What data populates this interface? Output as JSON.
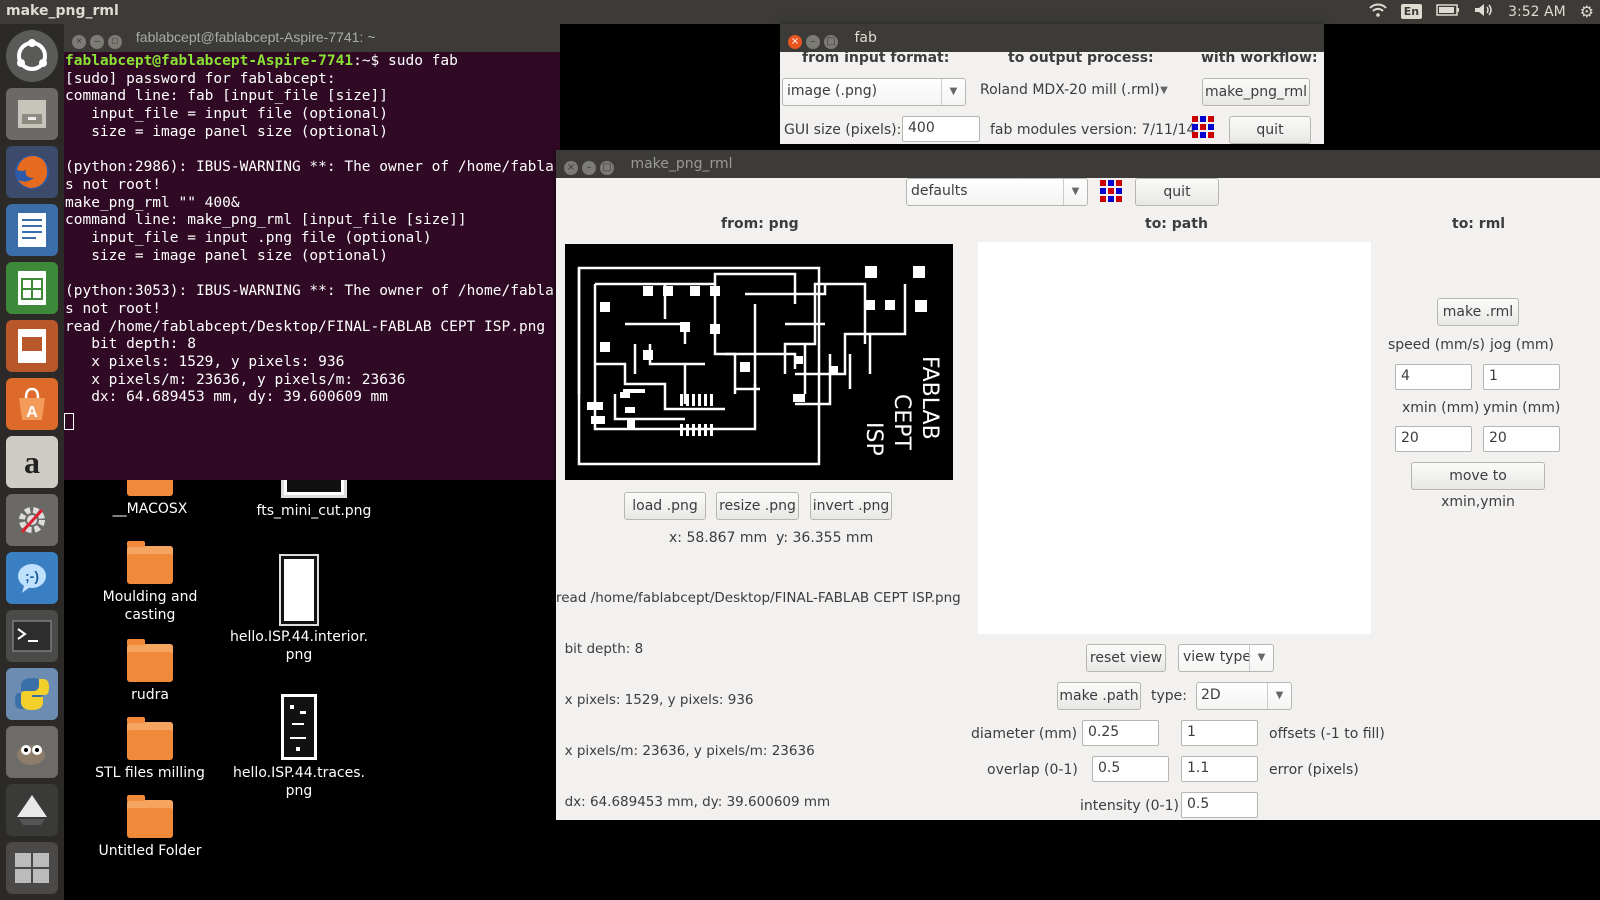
{
  "topbar": {
    "app_title": "make_png_rml",
    "lang": "En",
    "time": "3:52 AM"
  },
  "terminal": {
    "title": "fablabcept@fablabcept-Aspire-7741: ~",
    "prompt_user": "fablabcept@fablabcept-Aspire-7741",
    "prompt_rest": ":~$ sudo fab",
    "lines": [
      "[sudo] password for fablabcept:",
      "command line: fab [input_file [size]]",
      "   input_file = input file (optional)",
      "   size = image panel size (optional)",
      "",
      "(python:2986): IBUS-WARNING **: The owner of /home/fabla",
      "s not root!",
      "make_png_rml \"\" 400&",
      "command line: make_png_rml [input_file [size]]",
      "   input_file = input .png file (optional)",
      "   size = image panel size (optional)",
      "",
      "(python:3053): IBUS-WARNING **: The owner of /home/fabla",
      "s not root!",
      "read /home/fablabcept/Desktop/FINAL-FABLAB CEPT ISP.png",
      "   bit depth: 8",
      "   x pixels: 1529, y pixels: 936",
      "   x pixels/m: 23636, y pixels/m: 23636",
      "   dx: 64.689453 mm, dy: 39.600609 mm"
    ]
  },
  "desktop": {
    "items": [
      {
        "label": "__MACOSX"
      },
      {
        "label": "fts_mini_cut.png"
      },
      {
        "label": "Moulding and casting"
      },
      {
        "label": "hello.ISP.44.interior.png"
      },
      {
        "label": "rudra"
      },
      {
        "label": "hello.ISP.44.traces.png"
      },
      {
        "label": "STL files milling"
      },
      {
        "label": "Untitled Folder"
      }
    ]
  },
  "fab": {
    "title": "fab",
    "from_label": "from input format:",
    "to_label": "to output process:",
    "workflow_label": "with workflow:",
    "input_format": "image (.png)",
    "output_process": "Roland MDX-20 mill (.rml)",
    "workflow_button": "make_png_rml",
    "gui_size_label": "GUI size (pixels):",
    "gui_size_value": "400",
    "version_label": "fab modules version: 7/11/14",
    "quit": "quit"
  },
  "makepng": {
    "title": "make_png_rml",
    "defaults": "defaults",
    "quit": "quit",
    "from_png": "from: png",
    "to_path": "to: path",
    "to_rml": "to: rml",
    "pcb_text": [
      "FABLAB",
      "CEPT",
      "ISP"
    ],
    "load_png": "load .png",
    "resize_png": "resize .png",
    "invert_png": "invert .png",
    "coords": "x: 58.867 mm  y: 36.355 mm",
    "info_lines": [
      "read /home/fablabcept/Desktop/FINAL-FABLAB CEPT ISP.png",
      "  bit depth: 8",
      "  x pixels: 1529, y pixels: 936",
      "  x pixels/m: 23636, y pixels/m: 23636",
      "  dx: 64.689453 mm, dy: 39.600609 mm"
    ],
    "make_rml": "make .rml",
    "speed_label": "speed (mm/s)",
    "jog_label": "jog (mm)",
    "speed_value": "4",
    "jog_value": "1",
    "xmin_label": "xmin (mm)",
    "ymin_label": "ymin (mm)",
    "xmin_value": "20",
    "ymin_value": "20",
    "move_button": "move to xmin,ymin",
    "reset_view": "reset view",
    "view_type": "view type",
    "make_path": "make .path",
    "type_label": "type:",
    "type_value": "2D",
    "diameter_label": "diameter (mm)",
    "diameter_value": "0.25",
    "offsets_value": "1",
    "offsets_label": "offsets (-1 to fill)",
    "overlap_label": "overlap (0-1)",
    "overlap_value": "0.5",
    "error_value": "1.1",
    "error_label": "error (pixels)",
    "intensity_label": "intensity (0-1)",
    "intensity_value": "0.5"
  }
}
